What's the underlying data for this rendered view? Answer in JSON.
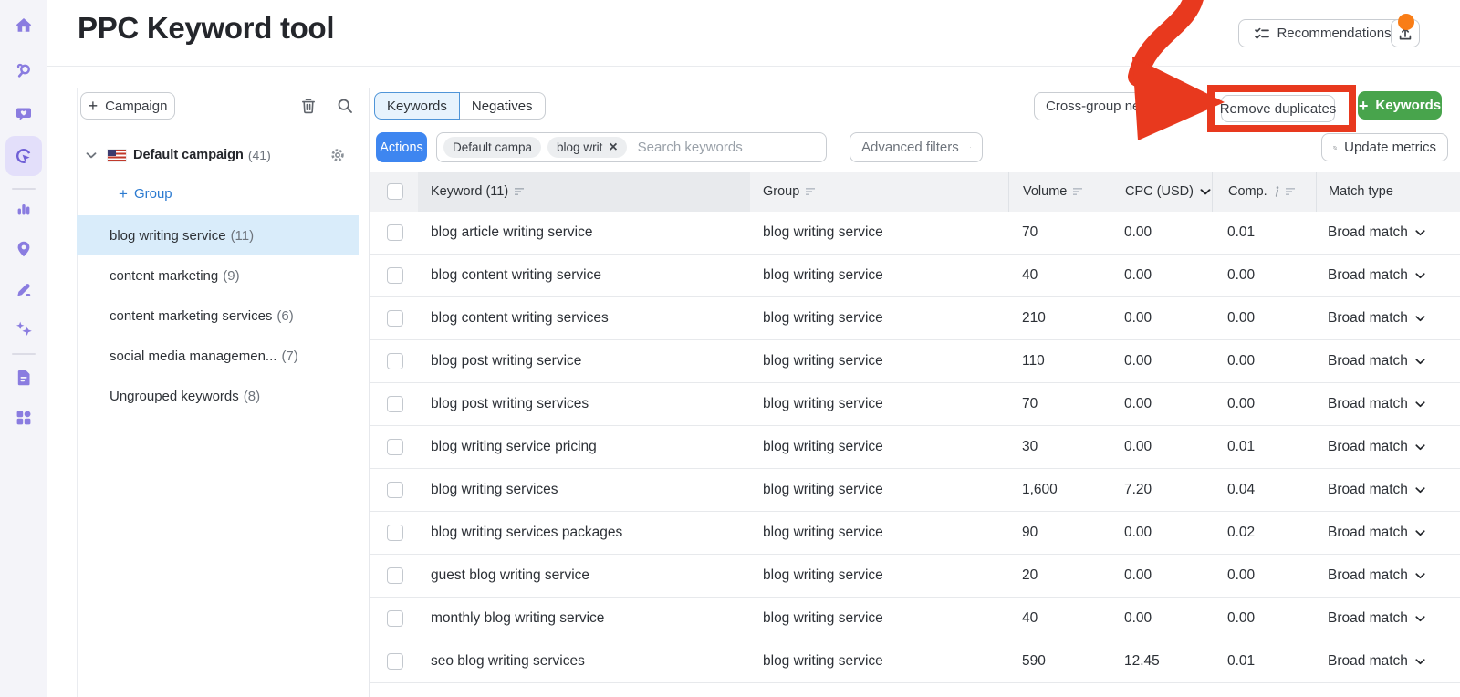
{
  "app": {
    "title": "PPC Keyword tool"
  },
  "header": {
    "recommendations_label": "Recommendations",
    "icons": [
      "checklist-icon",
      "upload-icon"
    ],
    "notification_dot_color": "#f97d16"
  },
  "colors": {
    "accent_blue": "#3e86f0",
    "link_blue": "#2b7ad0",
    "active_tab_bg": "#e7f3fd",
    "selected_group_bg": "#d9ecfa",
    "green_button": "#48a44c",
    "annotation_red": "#e8391e",
    "notification_orange": "#f97d16",
    "rail_icon_purple": "#8a7ce0",
    "header_row_bg": "#f1f2f4",
    "sorted_column_bg": "#e8eaed"
  },
  "rail": {
    "icons": [
      "home-icon",
      "competitive-research-icon",
      "social-media-icon",
      "advertising-icon",
      "analytics-icon",
      "local-icon",
      "content-icon",
      "ai-icon",
      "reports-icon",
      "apps-icon"
    ],
    "active": "advertising-icon"
  },
  "plus_glyph": "+",
  "panel": {
    "campaign_button_label": "Campaign",
    "icons": [
      "trash-icon",
      "search-icon",
      "gear-icon",
      "chevron-down-icon",
      "us-flag"
    ],
    "campaign": {
      "name": "Default campaign",
      "count": "(41)"
    },
    "add_group_label": "Group",
    "groups": [
      {
        "label": "blog writing service",
        "count": "(11)",
        "selected": true
      },
      {
        "label": "content marketing",
        "count": "(9)",
        "selected": false
      },
      {
        "label": "content marketing services",
        "count": "(6)",
        "selected": false
      },
      {
        "label": "social media managemen...",
        "count": "(7)",
        "selected": false
      },
      {
        "label": "Ungrouped keywords",
        "count": "(8)",
        "selected": false
      }
    ]
  },
  "toolbar": {
    "tabs": [
      {
        "label": "Keywords",
        "active": true
      },
      {
        "label": "Negatives",
        "active": false
      }
    ],
    "cross_group_label": "Cross-group negativ",
    "remove_duplicates_label": "Remove duplicates",
    "add_keywords_label": "Keywords",
    "actions_label": "Actions",
    "filter_chips": [
      "Default campa",
      "blog writ"
    ],
    "search_placeholder": "Search keywords",
    "advanced_filters_label": "Advanced filters",
    "update_metrics_label": "Update metrics"
  },
  "table": {
    "columns": [
      {
        "label": "Keyword (11)",
        "sortable": true,
        "sorted": true
      },
      {
        "label": "Group",
        "sortable": true
      },
      {
        "label": "Volume",
        "sortable": true
      },
      {
        "label": "CPC (USD)",
        "dropdown": true
      },
      {
        "label": "Comp.",
        "info": true,
        "sortable": true
      },
      {
        "label": "Match type"
      }
    ],
    "rows": [
      {
        "keyword": "blog article writing service",
        "group": "blog writing service",
        "volume": "70",
        "cpc": "0.00",
        "comp": "0.01",
        "match": "Broad match"
      },
      {
        "keyword": "blog content writing service",
        "group": "blog writing service",
        "volume": "40",
        "cpc": "0.00",
        "comp": "0.00",
        "match": "Broad match"
      },
      {
        "keyword": "blog content writing services",
        "group": "blog writing service",
        "volume": "210",
        "cpc": "0.00",
        "comp": "0.00",
        "match": "Broad match"
      },
      {
        "keyword": "blog post writing service",
        "group": "blog writing service",
        "volume": "110",
        "cpc": "0.00",
        "comp": "0.00",
        "match": "Broad match"
      },
      {
        "keyword": "blog post writing services",
        "group": "blog writing service",
        "volume": "70",
        "cpc": "0.00",
        "comp": "0.00",
        "match": "Broad match"
      },
      {
        "keyword": "blog writing service pricing",
        "group": "blog writing service",
        "volume": "30",
        "cpc": "0.00",
        "comp": "0.01",
        "match": "Broad match"
      },
      {
        "keyword": "blog writing services",
        "group": "blog writing service",
        "volume": "1,600",
        "cpc": "7.20",
        "comp": "0.04",
        "match": "Broad match"
      },
      {
        "keyword": "blog writing services packages",
        "group": "blog writing service",
        "volume": "90",
        "cpc": "0.00",
        "comp": "0.02",
        "match": "Broad match"
      },
      {
        "keyword": "guest blog writing service",
        "group": "blog writing service",
        "volume": "20",
        "cpc": "0.00",
        "comp": "0.00",
        "match": "Broad match"
      },
      {
        "keyword": "monthly blog writing service",
        "group": "blog writing service",
        "volume": "40",
        "cpc": "0.00",
        "comp": "0.00",
        "match": "Broad match"
      },
      {
        "keyword": "seo blog writing services",
        "group": "blog writing service",
        "volume": "590",
        "cpc": "12.45",
        "comp": "0.01",
        "match": "Broad match"
      }
    ]
  },
  "annotation": {
    "color": "#e8391e",
    "highlighted_button": "Remove duplicates"
  }
}
